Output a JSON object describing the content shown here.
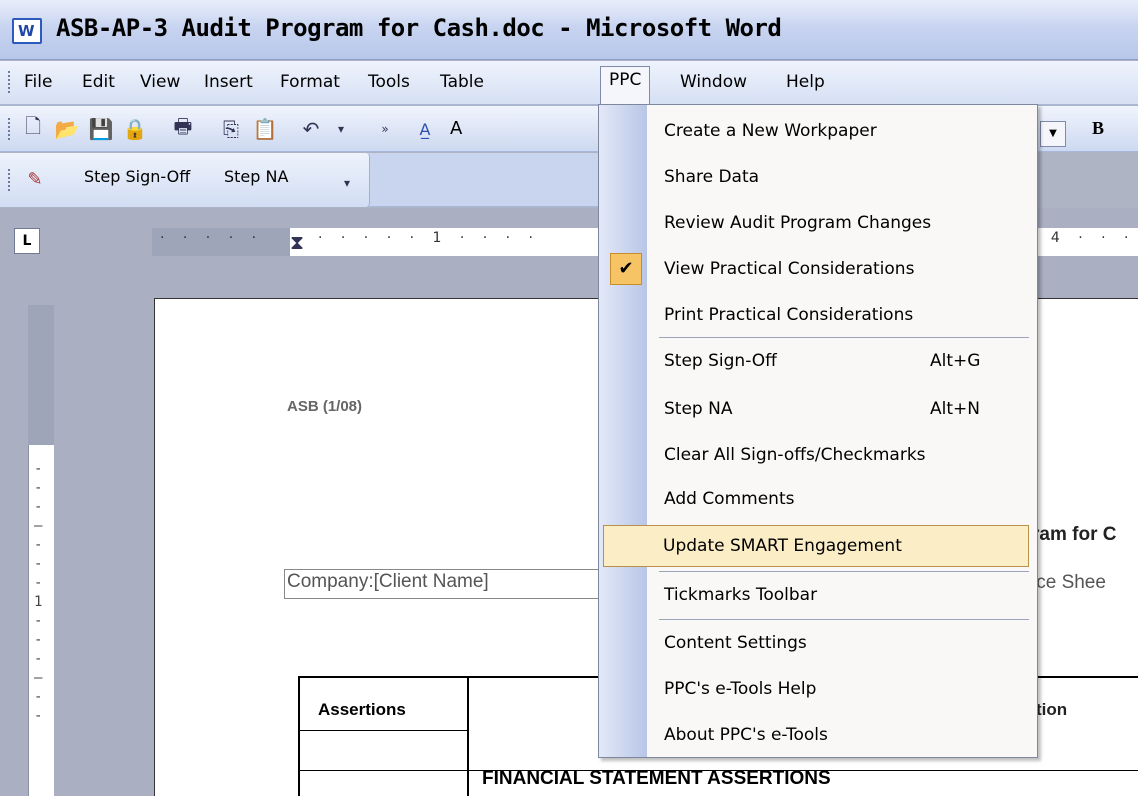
{
  "window": {
    "title": "ASB-AP-3 Audit Program for Cash.doc - Microsoft Word"
  },
  "menubar": {
    "items": [
      "File",
      "Edit",
      "View",
      "Insert",
      "Format",
      "Tools",
      "Table",
      "PPC",
      "Window",
      "Help"
    ]
  },
  "toolbar2": {
    "step_signoff": "Step Sign-Off",
    "step_na": "Step NA"
  },
  "toolbar1": {
    "font_fragment": "A",
    "bold": "B"
  },
  "ruler": {
    "marks_left": "· · · · ·",
    "marks_mid": "· · · · · 1 · · · ·",
    "marks_right": "· 4 · · ·"
  },
  "ppc_menu": {
    "items": [
      {
        "label": "Create a New Workpaper",
        "shortcut": ""
      },
      {
        "label": "Share Data",
        "shortcut": ""
      },
      {
        "label": "Review Audit Program Changes",
        "shortcut": ""
      },
      {
        "label": "View Practical Considerations",
        "shortcut": "",
        "checked": true
      },
      {
        "label": "Print Practical Considerations",
        "shortcut": ""
      },
      {
        "label": "Step Sign-Off",
        "shortcut": "Alt+G"
      },
      {
        "label": "Step NA",
        "shortcut": "Alt+N"
      },
      {
        "label": "Clear All Sign-offs/Checkmarks",
        "shortcut": ""
      },
      {
        "label": "Add Comments",
        "shortcut": ""
      },
      {
        "label": "Update SMART Engagement",
        "shortcut": "",
        "highlighted": true
      },
      {
        "label": "Tickmarks Toolbar",
        "shortcut": ""
      },
      {
        "label": "Content Settings",
        "shortcut": ""
      },
      {
        "label": "PPC's e-Tools Help",
        "shortcut": ""
      },
      {
        "label": "About PPC's e-Tools",
        "shortcut": ""
      }
    ]
  },
  "document": {
    "header": "ASB (1/08)",
    "title_fragment": "ram for C",
    "company_field": "Company:[Client Name]",
    "right_field_fragment": "ice Shee",
    "table": {
      "col1_header": "Assertions",
      "col3_header_fragment": "tion",
      "section_heading": "FINANCIAL STATEMENT ASSERTIONS"
    }
  },
  "colors": {
    "highlight": "#fbedc6",
    "check_bg": "#f6c465",
    "menu_strip": "#b8c5e6"
  }
}
